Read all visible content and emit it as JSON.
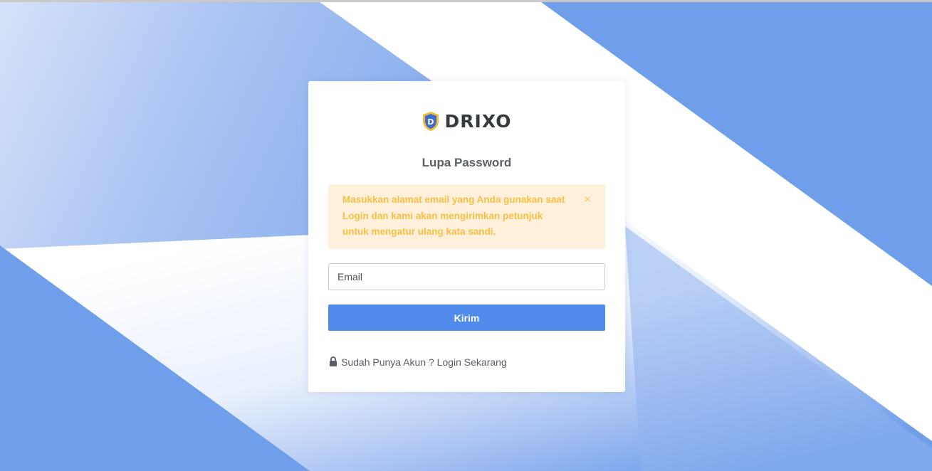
{
  "brand": {
    "name": "DRIXO",
    "logo_letter": "D",
    "logo_icon": "shield-icon"
  },
  "page": {
    "title": "Lupa Password"
  },
  "alert": {
    "message": "Masukkan alamat email yang Anda gunakan saat Login dan kami akan mengirimkan petunjuk untuk mengatur ulang kata sandi.",
    "close_glyph": "×",
    "close_icon": "close-icon"
  },
  "form": {
    "email_placeholder": "Email",
    "email_value": "",
    "submit_label": "Kirim"
  },
  "footer": {
    "login_link_label": "Sudah Punya Akun ? Login Sekarang",
    "link_icon": "lock-icon"
  },
  "colors": {
    "primary": "#508aeb",
    "background_blue": "#6f9eeb",
    "alert_bg": "#fff0db",
    "alert_text": "#f8bf45",
    "logo_gold": "#f4b93a",
    "logo_blue": "#3b6ccf",
    "text_dark": "#343a40",
    "text_muted": "#5a5f66"
  }
}
